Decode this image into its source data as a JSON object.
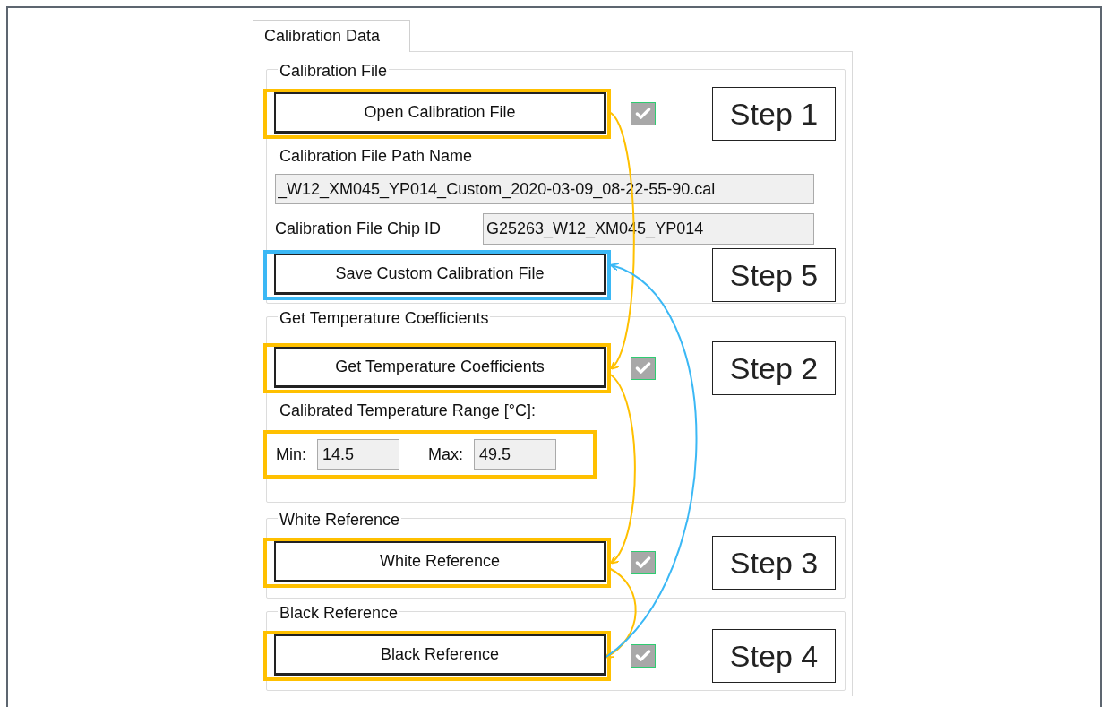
{
  "tab": {
    "label": "Calibration Data",
    "selected": true
  },
  "groups": [
    {
      "title": "Calibration File",
      "items": [
        {
          "kind": "button",
          "label": "Open Calibration File",
          "checkbox": {
            "checked": true
          },
          "color": "#ffc000",
          "step": "Step 1"
        },
        {
          "kind": "caption",
          "text": "Calibration File Path Name"
        },
        {
          "kind": "field",
          "value": "_W12_XM045_YP014_Custom_2020-03-09_08-22-55-90.cal"
        },
        {
          "kind": "labeled_field",
          "label": "Calibration File Chip ID",
          "value": "G25263_W12_XM045_YP014"
        },
        {
          "kind": "button",
          "label": "Save Custom Calibration File",
          "color": "#3bb8f5",
          "step": "Step 5"
        }
      ]
    },
    {
      "title": "Get Temperature Coefficients",
      "items": [
        {
          "kind": "button",
          "label": "Get Temperature Coefficients",
          "checkbox": {
            "checked": true
          },
          "color": "#ffc000",
          "step": "Step 2"
        },
        {
          "kind": "caption",
          "text": "Calibrated Temperature Range [°C]:"
        },
        {
          "kind": "range",
          "min_label": "Min:",
          "min_value": "14.5",
          "max_label": "Max:",
          "max_value": "49.5",
          "color": "#ffc000"
        }
      ]
    },
    {
      "title": "White Reference",
      "items": [
        {
          "kind": "button",
          "label": "White Reference",
          "checkbox": {
            "checked": true
          },
          "color": "#ffc000",
          "step": "Step 3"
        }
      ]
    },
    {
      "title": "Black Reference",
      "items": [
        {
          "kind": "button",
          "label": "Black Reference",
          "checkbox": {
            "checked": true
          },
          "color": "#ffc000",
          "step": "Step 4"
        }
      ]
    }
  ]
}
